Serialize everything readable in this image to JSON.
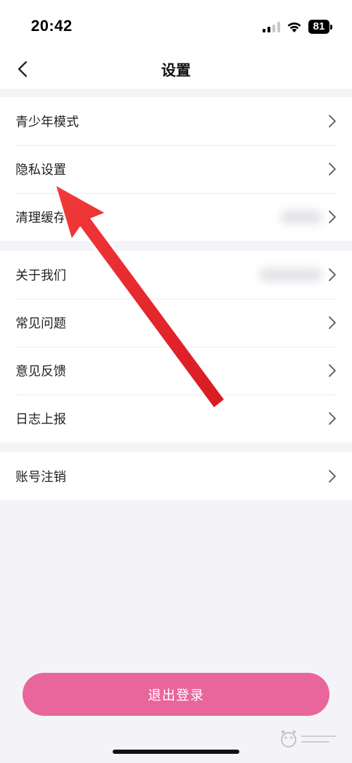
{
  "status_bar": {
    "time": "20:42",
    "battery": "81",
    "icons": [
      "cellular-signal-icon",
      "wifi-icon",
      "battery-icon"
    ]
  },
  "header": {
    "back_icon": "chevron-left-icon",
    "title": "设置"
  },
  "groups": [
    {
      "items": [
        {
          "label": "青少年模式"
        },
        {
          "label": "隐私设置"
        },
        {
          "label": "清理缓存"
        }
      ]
    },
    {
      "items": [
        {
          "label": "关于我们"
        },
        {
          "label": "常见问题"
        },
        {
          "label": "意见反馈"
        },
        {
          "label": "日志上报"
        }
      ]
    },
    {
      "items": [
        {
          "label": "账号注销"
        }
      ]
    }
  ],
  "logout": {
    "label": "退出登录"
  },
  "colors": {
    "background": "#f4f4f8",
    "surface": "#ffffff",
    "accent": "#e8669b",
    "annotation_arrow": "#e8202a"
  }
}
